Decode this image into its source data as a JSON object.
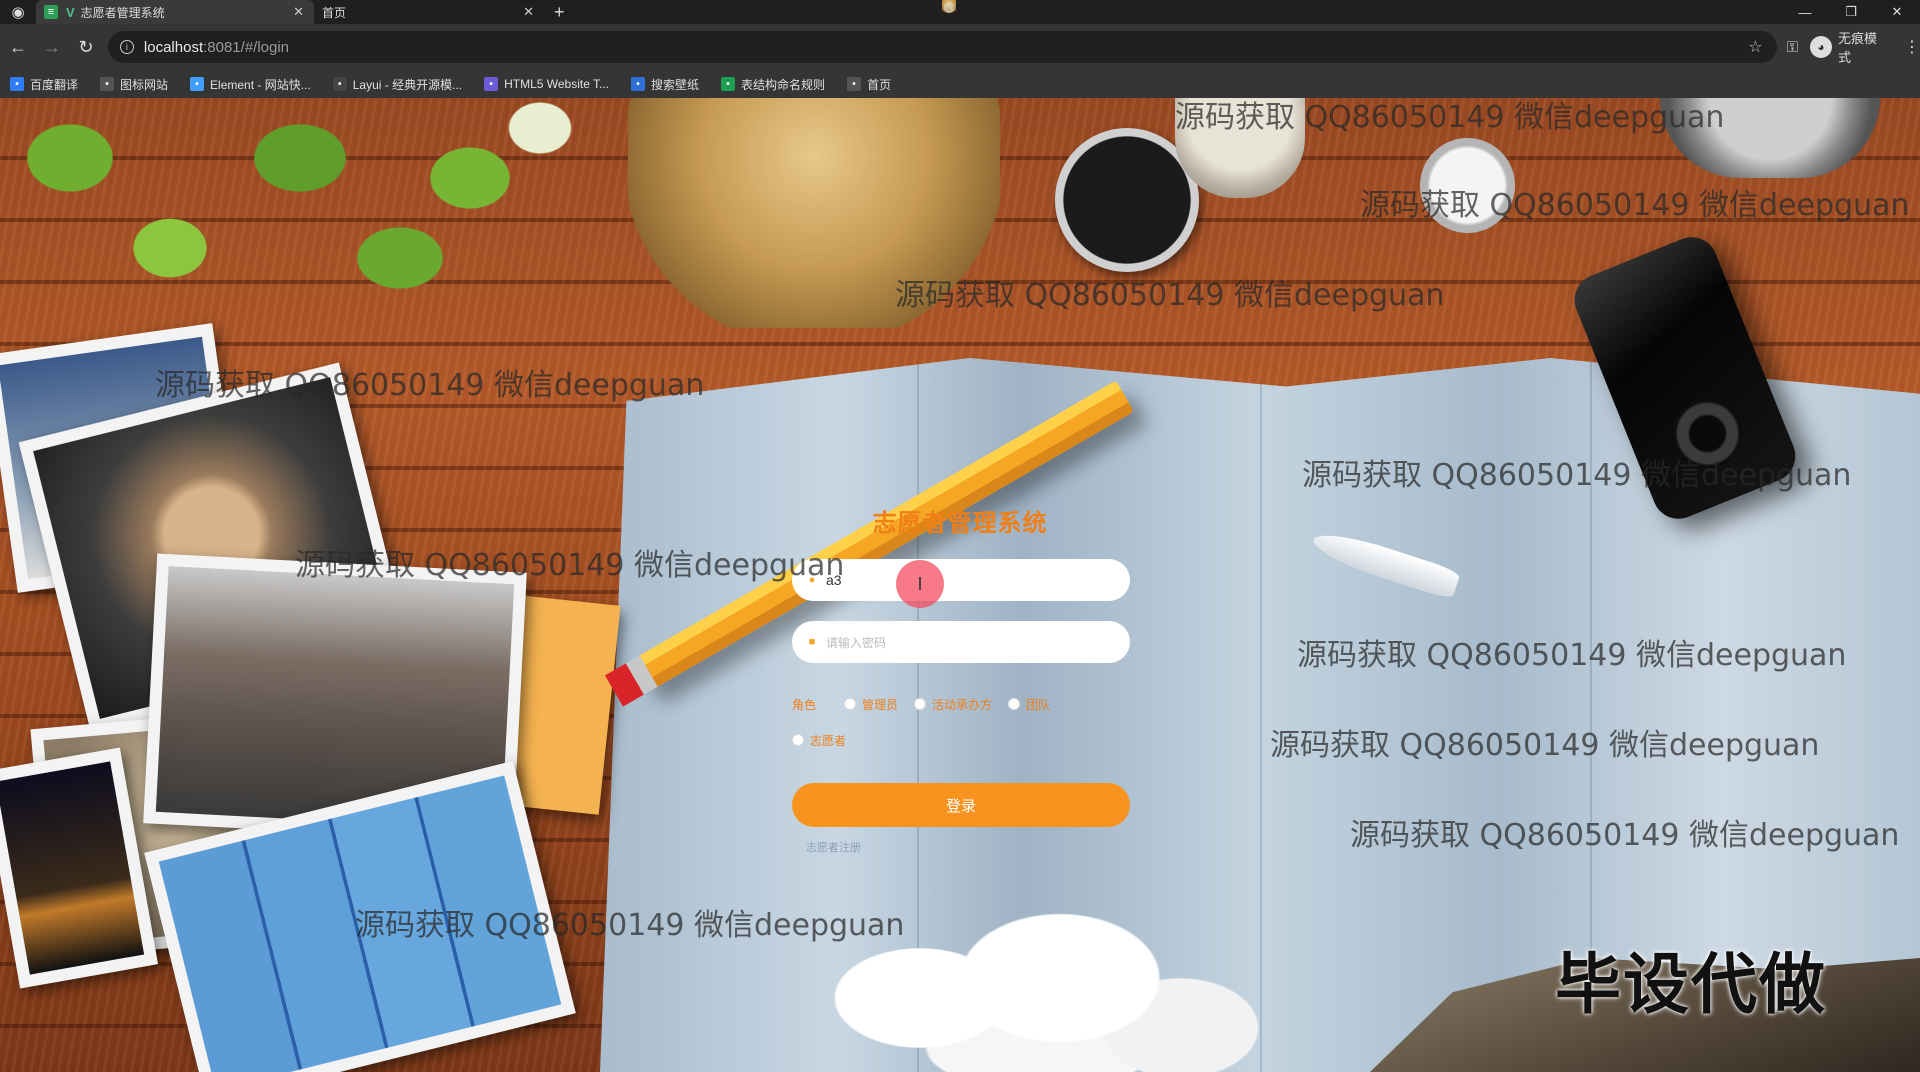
{
  "browser": {
    "tabs": [
      {
        "title": "志愿者管理系统",
        "active": true
      },
      {
        "title": "首页",
        "active": false
      }
    ],
    "new_tab": "+",
    "url_host": "localhost",
    "url_path": ":8081/#/login",
    "incognito_label": "无痕模式"
  },
  "bookmarks": [
    {
      "label": "百度翻译",
      "icon": "translate-icon",
      "color": "#2f7cf6"
    },
    {
      "label": "图标网站",
      "icon": "flag-icon",
      "color": "#555555"
    },
    {
      "label": "Element - 网站快...",
      "icon": "element-icon",
      "color": "#409eff"
    },
    {
      "label": "Layui - 经典开源模...",
      "icon": "layui-icon",
      "color": "#444444"
    },
    {
      "label": "HTML5 Website T...",
      "icon": "html5-icon",
      "color": "#6b5bd6"
    },
    {
      "label": "搜索壁纸",
      "icon": "wallpaper-icon",
      "color": "#2f6fd6"
    },
    {
      "label": "表结构命名规则",
      "icon": "sheet-icon",
      "color": "#1e9e55"
    },
    {
      "label": "首页",
      "icon": "globe-icon",
      "color": "#555555"
    }
  ],
  "watermarks": [
    "源码获取 QQ86050149 微信deepguan",
    "源码获取 QQ86050149 微信deepguan",
    "源码获取 QQ86050149 微信deepguan",
    "源码获取 QQ86050149 微信deepguan",
    "源码获取 QQ86050149 微信deepguan",
    "源码获取 QQ86050149 微信deepguan",
    "源码获取 QQ86050149 微信deepguan",
    "源码获取 QQ86050149 微信deepguan",
    "源码获取 QQ86050149 微信deepguan",
    "源码获取 QQ86050149 微信deepguan"
  ],
  "corner_stamp": "毕设代做",
  "login": {
    "title": "志愿者管理系统",
    "username_value": "a3",
    "password_placeholder": "请输入密码",
    "role_label": "角色",
    "roles": [
      "管理员",
      "活动承办方",
      "团队",
      "志愿者"
    ],
    "submit_label": "登录",
    "register_link": "志愿者注册"
  },
  "colors": {
    "accent": "#f7931e",
    "title": "#f07f16"
  }
}
